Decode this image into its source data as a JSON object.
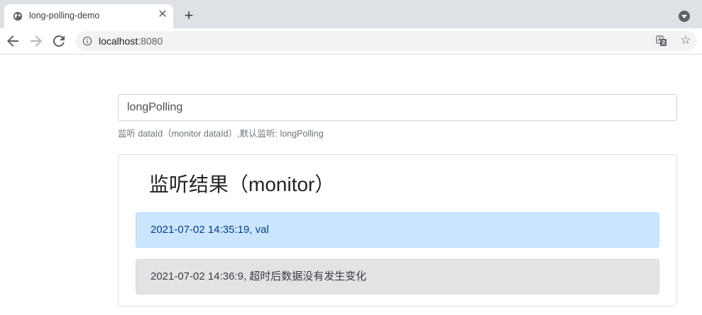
{
  "browser": {
    "tab_title": "long-polling-demo",
    "tab_close_glyph": "✕",
    "new_tab_glyph": "+",
    "url_host": "localhost",
    "url_port": ":8080",
    "star_glyph": "☆",
    "icons": [
      "globe-icon",
      "close-icon",
      "plus-icon",
      "profile-menu-icon",
      "back-icon",
      "forward-icon",
      "reload-icon",
      "info-icon",
      "translate-icon",
      "star-icon"
    ]
  },
  "form": {
    "input_value": "longPolling",
    "help_text": "监听 dataId（monitor dataId）,默认监听: longPolling"
  },
  "monitor": {
    "title": "监听结果（monitor）",
    "results": [
      {
        "text": "2021-07-02 14:35:19, val",
        "style": "primary"
      },
      {
        "text": "2021-07-02 14:36:9, 超时后数据没有发生变化",
        "style": "secondary"
      }
    ]
  },
  "colors": {
    "tabstrip": "#dee1e6",
    "primary_alert_bg": "#cce5ff",
    "primary_alert_text": "#004085",
    "secondary_alert_bg": "#e2e3e5",
    "secondary_alert_text": "#383d41"
  }
}
